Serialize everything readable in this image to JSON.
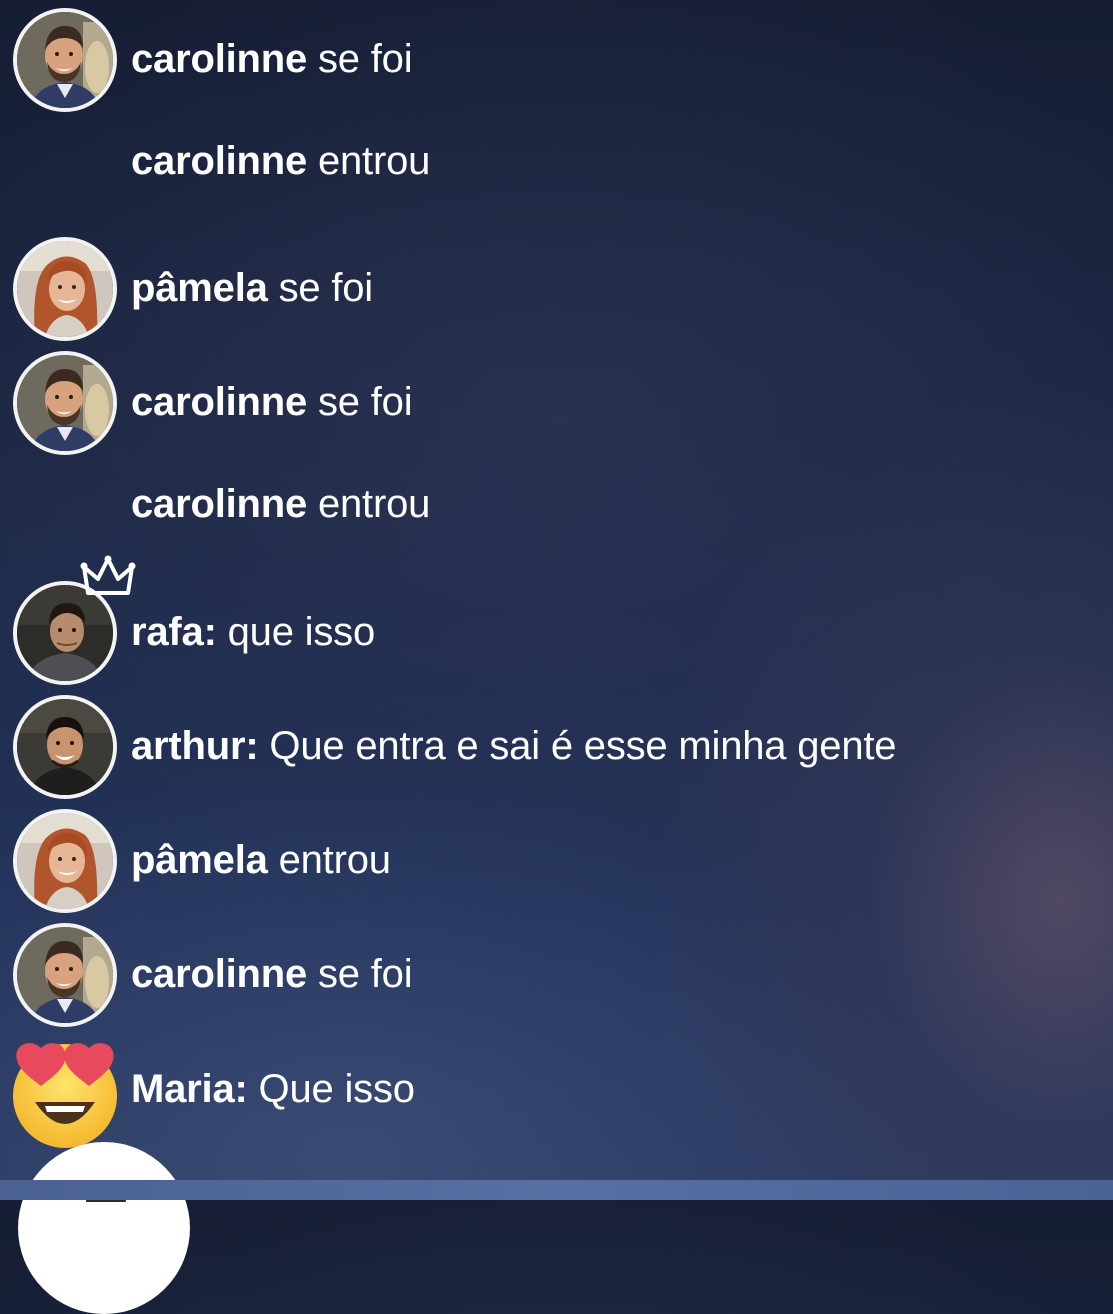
{
  "feed": [
    {
      "user": "carolinne",
      "text": "se foi",
      "avatar": "man-beard-avatar"
    },
    {
      "user": "carolinne",
      "text": "entrou",
      "avatar": ""
    },
    {
      "user": "pâmela",
      "text": "se foi",
      "avatar": "redhead-woman-avatar"
    },
    {
      "user": "carolinne",
      "text": "se foi",
      "avatar": "man-beard-avatar"
    },
    {
      "user": "carolinne",
      "text": "entrou",
      "avatar": ""
    },
    {
      "user": "rafa:",
      "text": "que isso",
      "avatar": "young-man-avatar",
      "badge": "crown-icon"
    },
    {
      "user": "arthur:",
      "text": "Que entra e sai é esse minha gente",
      "avatar": "smiling-man-avatar"
    },
    {
      "user": "pâmela",
      "text": "entrou",
      "avatar": "redhead-woman-avatar"
    },
    {
      "user": "carolinne",
      "text": "se foi",
      "avatar": "man-beard-avatar"
    },
    {
      "user": "Maria:",
      "text": "Que isso",
      "avatar": "heart-eyes-emoji-icon"
    }
  ],
  "colors": {
    "text": "#ffffff",
    "avatar_border": "#f3f3f3",
    "background_top": "#161d34",
    "background_bottom": "#2a3b63"
  }
}
